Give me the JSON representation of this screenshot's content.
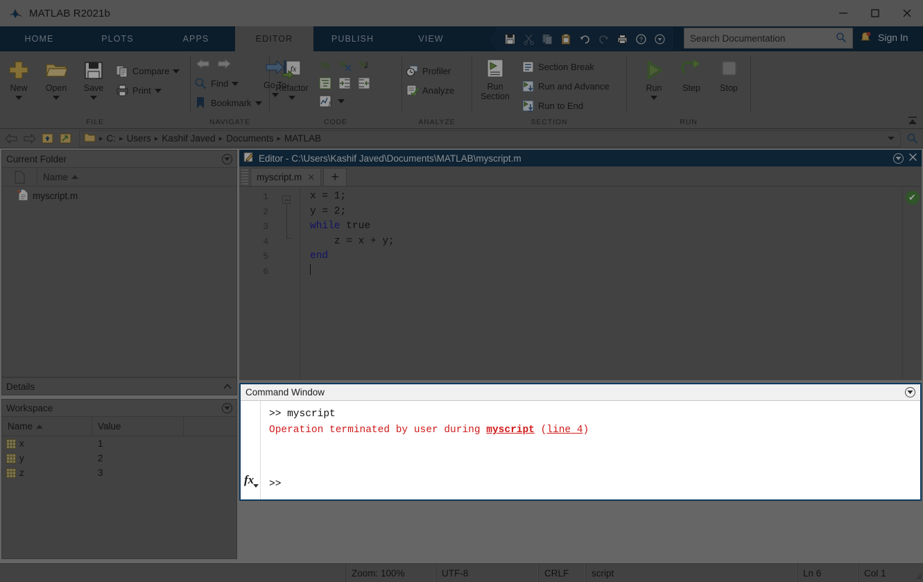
{
  "window": {
    "title": "MATLAB R2021b",
    "logo_icon": "matlab-logo-icon",
    "minimize_label": "—",
    "maximize_label": "□",
    "close_label": "✕"
  },
  "ribbon": {
    "tabs": [
      {
        "label": "HOME",
        "active": false
      },
      {
        "label": "PLOTS",
        "active": false
      },
      {
        "label": "APPS",
        "active": false
      },
      {
        "label": "EDITOR",
        "active": true
      },
      {
        "label": "PUBLISH",
        "active": false
      },
      {
        "label": "VIEW",
        "active": false
      }
    ],
    "quick_access": [
      "save-icon",
      "cut-icon",
      "copy-icon",
      "paste-icon",
      "undo-icon",
      "redo-icon",
      "print-icon",
      "help-icon",
      "customize-icon"
    ],
    "search": {
      "placeholder": "Search Documentation",
      "value": "",
      "icon": "search-icon"
    },
    "notification_icon": "bell-icon",
    "sign_in_label": "Sign In",
    "groups": [
      {
        "name": "FILE",
        "big_buttons": [
          {
            "label": "New",
            "icon": "new-file-icon",
            "has_dropdown": true
          },
          {
            "label": "Open",
            "icon": "open-folder-icon",
            "has_dropdown": true
          },
          {
            "label": "Save",
            "icon": "save-disk-icon",
            "has_dropdown": true
          }
        ],
        "small_buttons": [
          {
            "label": "Compare",
            "icon": "compare-icon",
            "has_dropdown": true
          },
          {
            "label": "Print",
            "icon": "print-icon",
            "has_dropdown": true
          }
        ]
      },
      {
        "name": "NAVIGATE",
        "big_buttons": [
          {
            "label": "Go To",
            "icon": "go-to-icon",
            "has_dropdown": true
          }
        ],
        "small_buttons": [
          {
            "label": "Find",
            "icon": "find-icon",
            "has_dropdown": true
          },
          {
            "label": "Bookmark",
            "icon": "bookmark-icon",
            "has_dropdown": true
          }
        ],
        "arrows": [
          "back-arrow-icon",
          "forward-arrow-icon"
        ]
      },
      {
        "name": "CODE",
        "big_buttons": [
          {
            "label": "Refactor",
            "icon": "refactor-fx-icon",
            "has_dropdown": true
          }
        ],
        "mini_icons": [
          "comment-icon",
          "uncomment-icon",
          "wrap-comment-icon",
          "smart-indent-icon",
          "indent-right-icon",
          "indent-left-icon",
          "profile-code-icon"
        ]
      },
      {
        "name": "ANALYZE",
        "small_buttons": [
          {
            "label": "Profiler",
            "icon": "profiler-icon",
            "has_dropdown": false
          },
          {
            "label": "Analyze",
            "icon": "analyze-icon",
            "has_dropdown": false
          }
        ]
      },
      {
        "name": "SECTION",
        "big_buttons": [
          {
            "label": "Run\nSection",
            "icon": "run-section-icon",
            "has_dropdown": false
          }
        ],
        "small_buttons": [
          {
            "label": "Section Break",
            "icon": "section-break-icon",
            "has_dropdown": false
          },
          {
            "label": "Run and Advance",
            "icon": "run-advance-icon",
            "has_dropdown": false
          },
          {
            "label": "Run to End",
            "icon": "run-to-end-icon",
            "has_dropdown": false
          }
        ]
      },
      {
        "name": "RUN",
        "big_buttons": [
          {
            "label": "Run",
            "icon": "run-play-icon",
            "has_dropdown": true
          },
          {
            "label": "Step",
            "icon": "step-icon",
            "has_dropdown": false
          },
          {
            "label": "Stop",
            "icon": "stop-icon",
            "has_dropdown": false
          }
        ]
      }
    ],
    "collapse_icon": "collapse-ribbon-icon"
  },
  "address_bar": {
    "nav_icons": [
      "back-icon",
      "forward-icon",
      "up-one-level-icon",
      "browse-folder-icon"
    ],
    "folder_icon": "folder-icon",
    "crumbs": [
      "C:",
      "Users",
      "Kashif Javed",
      "Documents",
      "MATLAB"
    ],
    "dropdown_icon": "chevron-down-icon",
    "search_icon": "search-icon"
  },
  "current_folder": {
    "title": "Current Folder",
    "panel_menu_icon": "panel-options-icon",
    "column_icon": "file-column-icon",
    "columns": [
      "Name"
    ],
    "sort_indicator": "sort-ascending-icon",
    "files": [
      {
        "name": "myscript.m",
        "icon": "m-file-icon"
      }
    ]
  },
  "details": {
    "title": "Details",
    "expander_icon": "chevron-up-icon"
  },
  "workspace": {
    "title": "Workspace",
    "panel_menu_icon": "panel-options-icon",
    "columns": [
      "Name",
      "Value",
      ""
    ],
    "sort_indicator": "sort-ascending-icon",
    "variables": [
      {
        "name": "x",
        "value": "1",
        "icon": "array-variable-icon"
      },
      {
        "name": "y",
        "value": "2",
        "icon": "array-variable-icon"
      },
      {
        "name": "z",
        "value": "3",
        "icon": "array-variable-icon"
      }
    ]
  },
  "editor": {
    "title": "Editor - C:\\Users\\Kashif Javed\\Documents\\MATLAB\\myscript.m",
    "title_icon": "editor-pencil-icon",
    "panel_menu_icon": "panel-options-icon",
    "close_icon": "close-icon",
    "tabs": [
      {
        "label": "myscript.m",
        "close_icon": "close-tab-icon",
        "active": true
      }
    ],
    "new_tab_label": "+",
    "line_numbers": [
      "1",
      "2",
      "3",
      "4",
      "5",
      "6"
    ],
    "code_lines": [
      {
        "n": 1,
        "indent": "",
        "text": "x = 1;",
        "keyword": ""
      },
      {
        "n": 2,
        "indent": "",
        "text": "y = 2;",
        "keyword": ""
      },
      {
        "n": 3,
        "indent": "",
        "text": " true",
        "keyword": "while"
      },
      {
        "n": 4,
        "indent": "    ",
        "text": "z = x + y;",
        "keyword": ""
      },
      {
        "n": 5,
        "indent": "",
        "text": "",
        "keyword": "end"
      },
      {
        "n": 6,
        "indent": "",
        "text": "",
        "keyword": ""
      }
    ],
    "analyzer_status_icon": "analyzer-ok-icon",
    "analyzer_status_mark": "✔",
    "fold_marker_icon": "fold-collapse-icon"
  },
  "command_window": {
    "title": "Command Window",
    "panel_menu_icon": "panel-options-icon",
    "fx_icon": "fx-icon",
    "lines": [
      {
        "type": "input",
        "text": ">> myscript"
      },
      {
        "type": "error",
        "prefix": "Operation terminated by user during ",
        "link": "myscript",
        "mid": " (",
        "link2": "line 4",
        "suffix": ")"
      }
    ],
    "prompt": ">>"
  },
  "status_bar": {
    "zoom": "Zoom: 100%",
    "encoding": "UTF-8",
    "line_ending": "CRLF",
    "file_type": "script",
    "line": "Ln  6",
    "column": "Col  1"
  },
  "colors": {
    "matlab_blue": "#0d3a5f",
    "ribbon_grey": "#6a6a6a",
    "keyword_blue": "#1a1ad0",
    "error_red": "#d01a1a",
    "ok_green": "#3f8f2f",
    "accent_orange": "#d95319"
  }
}
